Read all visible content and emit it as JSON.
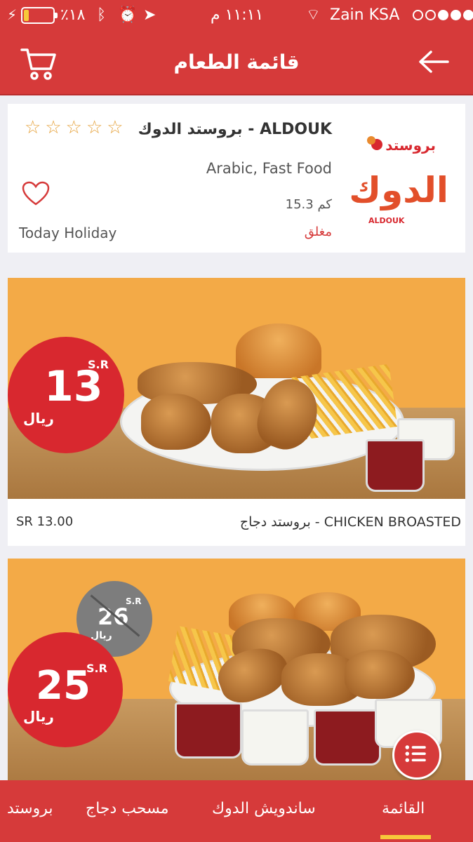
{
  "status_bar": {
    "battery_text": "٪١٨",
    "time": "١١:١١ م",
    "carrier": "Zain KSA",
    "battery_level": 0.18,
    "signal_bars": 3
  },
  "header": {
    "title": "قائمة الطعام",
    "cart_icon": "cart-icon",
    "back_icon": "arrow-left-icon"
  },
  "restaurant": {
    "name": "بروستد الدوك - ALDOUK",
    "cuisine": "Arabic, Fast Food",
    "distance": "15.3 كم",
    "status": "مغلق",
    "holiday": "Today Holiday",
    "rating": 0,
    "rating_max": 5,
    "logo_text": "بروستد",
    "logo_main": "الدوك",
    "logo_sub": "ALDOUK"
  },
  "items": [
    {
      "name": "بروستد دجاج - CHICKEN BROASTED",
      "price": "SR 13.00",
      "badge_number": "13",
      "badge_currency": "S.R",
      "badge_riyal": "ريال"
    },
    {
      "badge_number": "25",
      "badge_currency": "S.R",
      "badge_riyal": "ريال",
      "old_number": "26",
      "old_currency": "S.R",
      "old_riyal": "ريال"
    }
  ],
  "tabs": [
    {
      "label": "القائمة",
      "active": true
    },
    {
      "label": "ساندويش الدوك",
      "active": false
    },
    {
      "label": "مسحب دجاج",
      "active": false
    },
    {
      "label": "بروستد",
      "active": false
    }
  ],
  "colors": {
    "primary": "#d63a3a",
    "accent": "#f7c83a",
    "background": "#efeff4",
    "photo_background": "#f3aa47"
  }
}
